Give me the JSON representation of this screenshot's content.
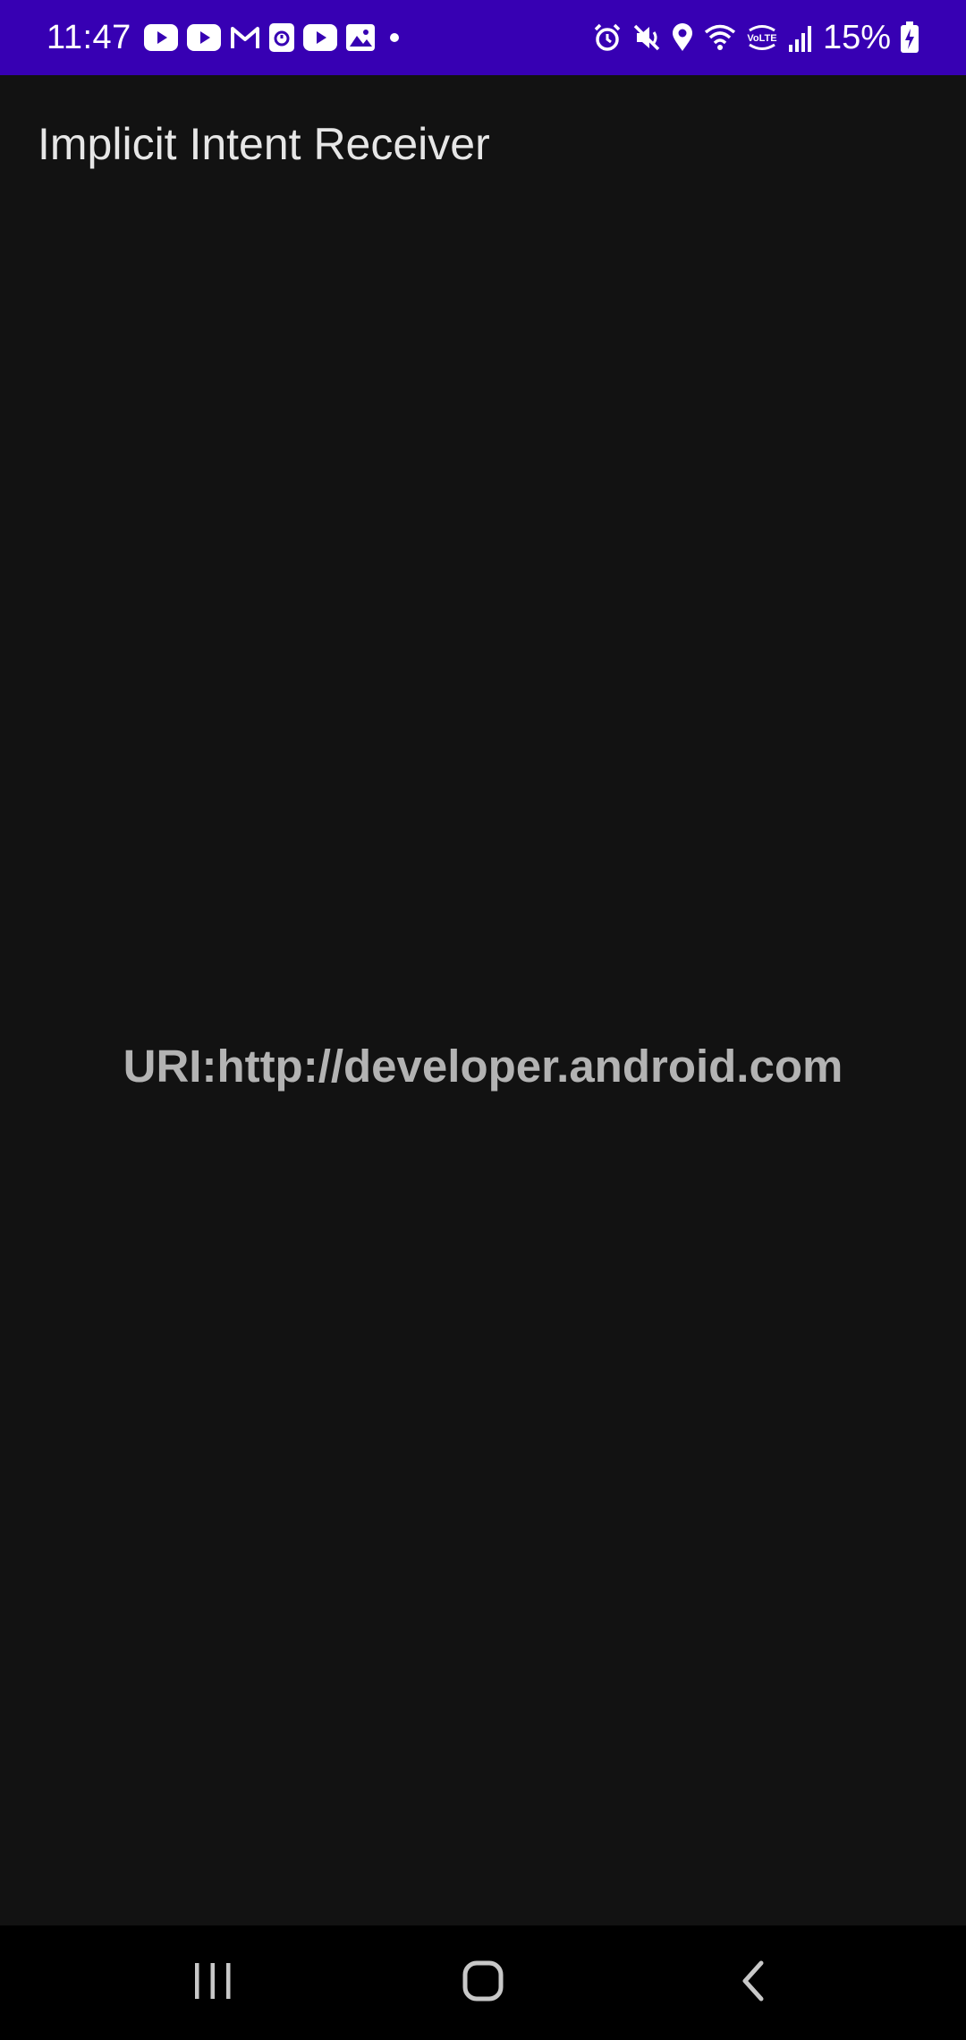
{
  "status_bar": {
    "time": "11:47",
    "battery_percent": "15%",
    "background_color": "#3700b3",
    "notification_icons": [
      "youtube-icon",
      "youtube-icon",
      "gmail-icon",
      "calendar-icon",
      "youtube-icon",
      "gallery-icon",
      "more-dot-icon"
    ],
    "system_icons": [
      "alarm-icon",
      "mute-icon",
      "location-icon",
      "wifi-icon",
      "volte-icon",
      "signal-icon",
      "battery-charging-icon"
    ]
  },
  "app": {
    "title": "Implicit Intent Receiver",
    "uri_text": "URI:http://developer.android.com",
    "background_color": "#121212"
  },
  "nav_bar": {
    "buttons": [
      "recent-apps",
      "home",
      "back"
    ]
  }
}
